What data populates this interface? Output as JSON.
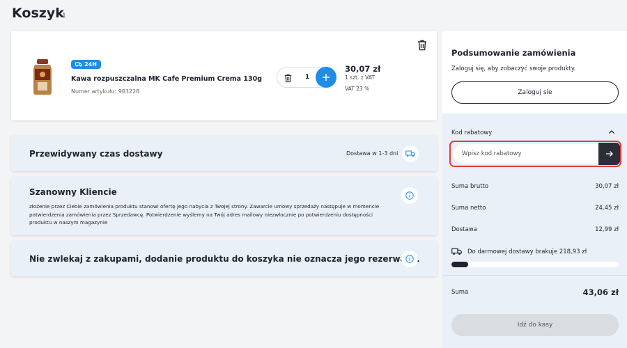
{
  "page": {
    "title": "Koszyk",
    "count": "1"
  },
  "product": {
    "badge": "24H",
    "name": "Kawa rozpuszczalna MK Cafe Premium Crema 130g",
    "sku": "Numer artykułu: 983228",
    "quantity": "1",
    "price": "30,07 zł",
    "per_unit": "1 szt. z VAT",
    "vat": "VAT 23 %"
  },
  "delivery": {
    "heading": "Przewidywany czas dostawy",
    "time": "Dostawa w 1-3 dni"
  },
  "notice": {
    "heading": "Szanowny Kliencie",
    "text": "złożenie przez Ciebie zamówienia produktu stanowi ofertę jego nabycia z Twojej strony. Zawarcie umowy sprzedaży następuje w momencie potwierdzenia zamówienia przez Sprzedawcę. Potwierdzenie wyślemy na Twój adres mailowy niezwłocznie po potwierdzeniu dostępności produktu w naszym magazynie"
  },
  "warning": {
    "heading": "Nie zwlekaj z zakupami, dodanie produktu do koszyka nie oznacza jego rezerwacji."
  },
  "summary": {
    "title": "Podsumowanie zamówienia",
    "subtitle": "Zaloguj się, aby zobaczyć swoje produkty.",
    "login_label": "Zaloguj sie",
    "coupon_label": "Kod rabatowy",
    "coupon_placeholder": "Wpisz kod rabatowy",
    "rows": [
      {
        "label": "Suma brutto",
        "value": "30,07 zł"
      },
      {
        "label": "Suma netto",
        "value": "24,45 zł"
      },
      {
        "label": "Dostawa",
        "value": "12,99 zł"
      }
    ],
    "free_shipping_text": "Do darmowej dostawy brakuje 218,93 zł",
    "free_shipping_progress": 0.1,
    "total_label": "Suma",
    "total_value": "43,06 zł",
    "checkout_label": "Idź do kasy"
  },
  "colors": {
    "accent": "#1f8de8",
    "highlight": "#e23b3b",
    "dark": "#2b2e36",
    "panel": "#eaf0f8"
  }
}
